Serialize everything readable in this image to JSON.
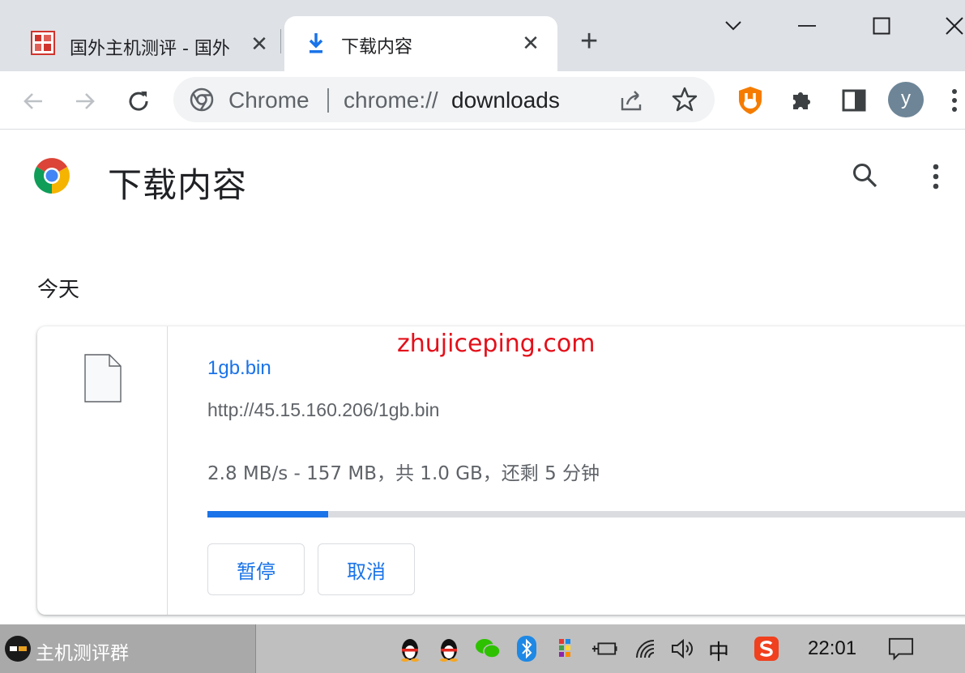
{
  "tabs": [
    {
      "title": "国外主机测评 - 国外",
      "active": false
    },
    {
      "title": "下载内容",
      "active": true
    }
  ],
  "new_tab_label": "+",
  "omnibox": {
    "chip": "Chrome",
    "url_scheme": "chrome://",
    "url_path": "downloads"
  },
  "profile_initial": "y",
  "page": {
    "title": "下载内容",
    "date_group": "今天"
  },
  "download": {
    "file_name": "1gb.bin",
    "url": "http://45.15.160.206/1gb.bin",
    "status": "2.8 MB/s - 157 MB，共 1.0 GB，还剩 5 分钟",
    "progress_fraction": 0.157,
    "pause_label": "暂停",
    "cancel_label": "取消"
  },
  "watermark": "zhujiceping.com",
  "taskbar": {
    "app_label": "主机测评群",
    "ime": "中",
    "time": "22:01"
  },
  "colors": {
    "accent": "#1a73e8",
    "tabstrip": "#dee1e6",
    "watermark": "#e3101a",
    "taskbar": "#bfbfbf"
  }
}
